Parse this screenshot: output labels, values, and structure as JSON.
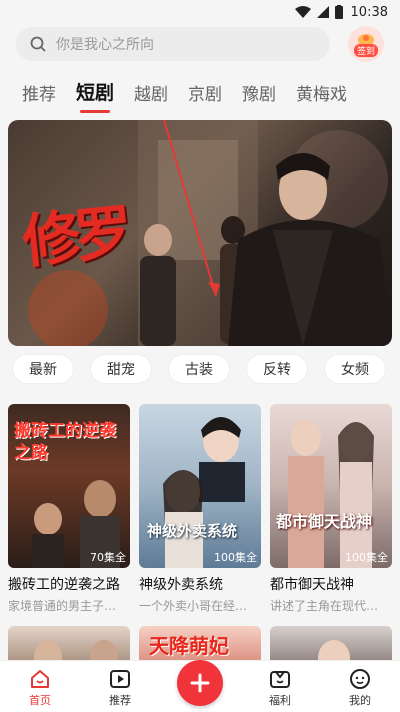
{
  "status_bar": {
    "time": "10:38"
  },
  "search": {
    "placeholder": "你是我心之所向",
    "sign_label": "签到"
  },
  "tabs": [
    {
      "label": "推荐",
      "active": false
    },
    {
      "label": "短剧",
      "active": true
    },
    {
      "label": "越剧",
      "active": false
    },
    {
      "label": "京剧",
      "active": false
    },
    {
      "label": "豫剧",
      "active": false
    },
    {
      "label": "黄梅戏",
      "active": false
    }
  ],
  "banner": {
    "title": "修罗"
  },
  "chips": [
    "最新",
    "甜宠",
    "古装",
    "反转",
    "女频"
  ],
  "cards": [
    {
      "title": "搬砖工的逆袭之路",
      "desc": "家境普通的男主子…",
      "episodes": "70集全",
      "poster_text": "搬砖工的逆袭之路"
    },
    {
      "title": "神级外卖系统",
      "desc": "一个外卖小哥在经…",
      "episodes": "100集全",
      "poster_text": "神级外卖系统"
    },
    {
      "title": "都市御天战神",
      "desc": "讲述了主角在现代…",
      "episodes": "100集全",
      "poster_text": "都市御天战神"
    }
  ],
  "cards_row2": [
    {
      "poster_text": ""
    },
    {
      "poster_text": "天降萌妃"
    },
    {
      "poster_text": ""
    }
  ],
  "bottom_nav": {
    "home": "首页",
    "recommend": "推荐",
    "welfare": "福利",
    "mine": "我的"
  },
  "colors": {
    "accent": "#e53935",
    "add_button": "#f0343a"
  }
}
